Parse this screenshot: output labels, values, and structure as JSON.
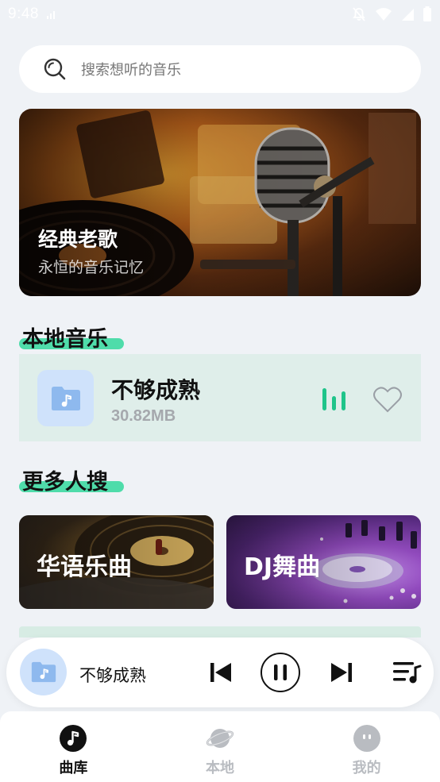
{
  "status_bar": {
    "time": "9:48"
  },
  "search": {
    "placeholder": "搜索想听的音乐"
  },
  "banner": {
    "title": "经典老歌",
    "subtitle": "永恒的音乐记忆"
  },
  "local_section": {
    "title": "本地音乐",
    "track": {
      "name": "不够成熟",
      "size": "30.82MB",
      "playing_icon": "equalizer-icon",
      "favorite_icon": "heart-outline-icon"
    }
  },
  "more_section": {
    "title": "更多人搜",
    "tiles": [
      {
        "label": "华语乐曲"
      },
      {
        "label": "DJ舞曲"
      }
    ]
  },
  "player": {
    "title": "不够成熟",
    "state": "playing"
  },
  "nav": {
    "items": [
      {
        "label": "曲库",
        "icon": "music-note-icon",
        "active": true
      },
      {
        "label": "本地",
        "icon": "planet-icon",
        "active": false
      },
      {
        "label": "我的",
        "icon": "profile-icon",
        "active": false
      }
    ]
  },
  "colors": {
    "accent": "#1fc48a",
    "highlight": "#4fdcaa",
    "card_bg": "#dfeeea",
    "page_bg": "#eff2f6"
  }
}
